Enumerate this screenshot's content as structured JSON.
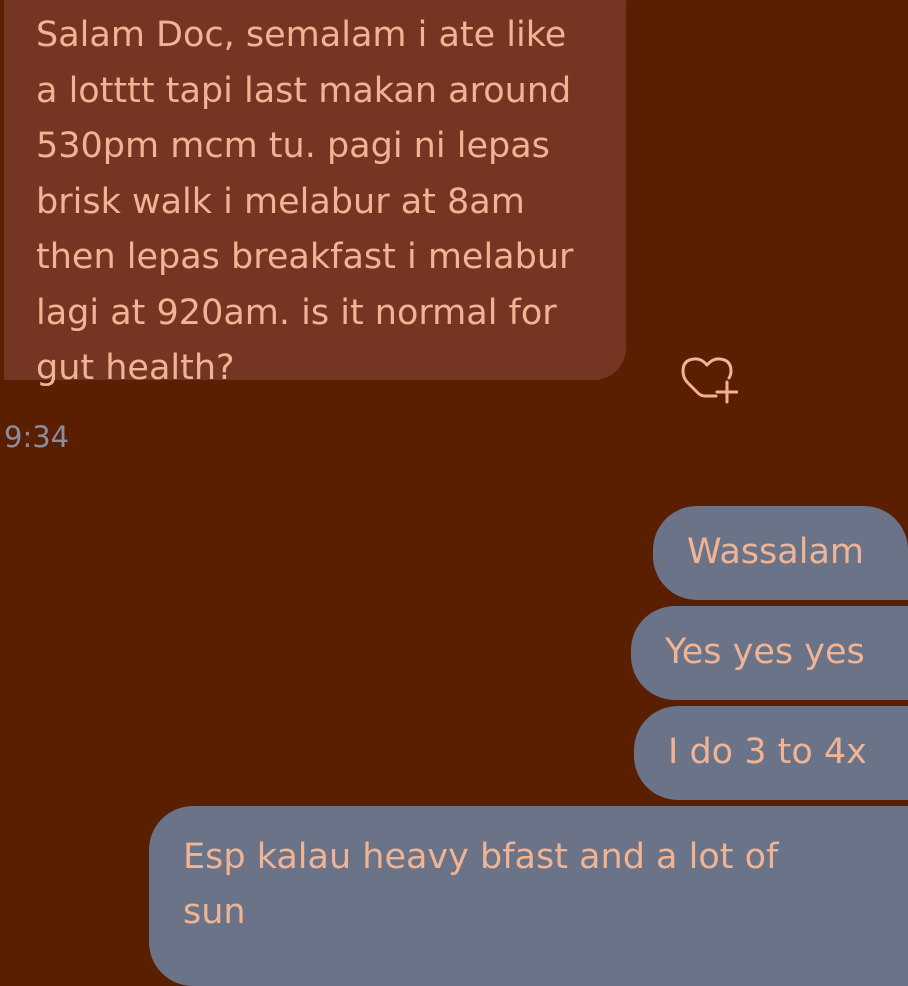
{
  "conversation": {
    "incoming": {
      "lines": [
        "Salam Doc, semalam i ate like",
        "a lotttt tapi last makan around",
        "530pm mcm tu. pagi ni lepas",
        "brisk walk i melabur at 8am",
        "then lepas breakfast i melabur",
        "lagi at 920am. is it normal for",
        "gut health?"
      ],
      "timestamp": "9:34",
      "react_icon": "heart-plus-icon"
    },
    "outgoing": [
      {
        "text": "Wassalam"
      },
      {
        "text": "Yes yes yes"
      },
      {
        "text": "I do 3 to 4x"
      },
      {
        "lines": [
          "Esp kalau heavy bfast and a lot of",
          "sun"
        ]
      }
    ]
  },
  "colors": {
    "background": "#5a1e00",
    "incoming_bubble": "#743622",
    "outgoing_bubble": "#6a7387",
    "message_text": "#f0b393",
    "timestamp_text": "#8d8c9d"
  }
}
